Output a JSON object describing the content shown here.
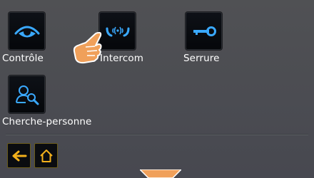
{
  "menu": {
    "items": [
      {
        "label": "Contrôle",
        "icon": "eye-icon"
      },
      {
        "label": "Intercom",
        "icon": "intercom-handset-icon"
      },
      {
        "label": "Serrure",
        "icon": "key-icon"
      },
      {
        "label": "Cherche-personne",
        "icon": "person-search-icon"
      }
    ]
  },
  "nav": {
    "back_icon": "arrow-left-icon",
    "home_icon": "home-icon"
  },
  "colors": {
    "background": "#4b4c4f",
    "icon_blue": "#3aa9ff",
    "nav_accent": "#f2b01b",
    "cursor_orange": "#f0a05a"
  }
}
